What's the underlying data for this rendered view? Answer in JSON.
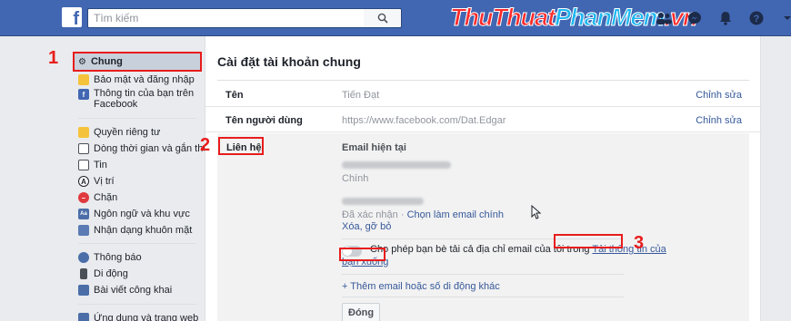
{
  "topbar": {
    "logo": "f",
    "search_placeholder": "Tìm kiếm",
    "brand_part1": "ThuThuat",
    "brand_part2": "PhanMem",
    "brand_part3": ".vn",
    "colors": {
      "bar": "#4267b2",
      "brand_red": "#ff2a2a",
      "brand_blue": "#1db7f0"
    }
  },
  "sidebar": {
    "items": [
      {
        "label": "Chung",
        "icon": "gear-icon"
      },
      {
        "label": "Bảo mật và đăng nhập",
        "icon": "shield-icon"
      },
      {
        "label": "Thông tin của bạn trên",
        "label2": "Facebook",
        "icon": "facebook-icon"
      },
      {
        "label": "Quyền riêng tư",
        "icon": "lock-icon"
      },
      {
        "label": "Dòng thời gian và gắn thẻ",
        "icon": "timeline-icon"
      },
      {
        "label": "Tin",
        "icon": "book-icon"
      },
      {
        "label": "Vị trí",
        "icon": "location-icon"
      },
      {
        "label": "Chặn",
        "icon": "block-icon"
      },
      {
        "label": "Ngôn ngữ và khu vực",
        "icon": "language-icon"
      },
      {
        "label": "Nhận dạng khuôn mặt",
        "icon": "face-icon"
      },
      {
        "label": "Thông báo",
        "icon": "globe-icon"
      },
      {
        "label": "Di động",
        "icon": "mobile-icon"
      },
      {
        "label": "Bài viết công khai",
        "icon": "rss-icon"
      },
      {
        "label": "Ứng dụng và trang web",
        "icon": "apps-icon"
      }
    ]
  },
  "main": {
    "title": "Cài đặt tài khoản chung",
    "rows": [
      {
        "label": "Tên",
        "value": "Tiến Đạt",
        "edit": "Chỉnh sửa"
      },
      {
        "label": "Tên người dùng",
        "value": "https://www.facebook.com/Dat.Edgar",
        "edit": "Chỉnh sửa"
      }
    ],
    "contact": {
      "label": "Liên hệ",
      "heading": "Email hiện tại",
      "primary_tag": "Chính",
      "verified": "Đã xác nhận",
      "dot": "·",
      "make_primary": "Chọn làm email chính",
      "remove": "Xóa, gỡ bỏ",
      "toggle_text": "Cho phép bạn bè tải cả địa chỉ email của tôi trong",
      "download_link_1": "Tải thông tin của",
      "download_link_2": "bạn xuống",
      "add_email": "+ Thêm email hoặc số di động khác",
      "close": "Đóng"
    }
  },
  "annotations": {
    "n1": "1",
    "n2": "2",
    "n3": "3",
    "color": "#e81c1c"
  }
}
